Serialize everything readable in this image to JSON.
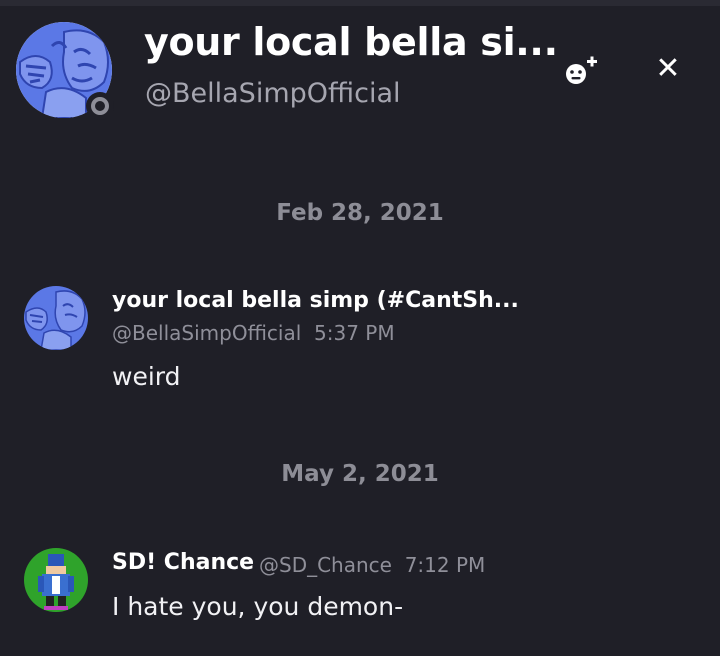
{
  "colors": {
    "background": "#1f1f27",
    "text_primary": "#ffffff",
    "text_muted": "#8f8f99",
    "avatar_blue": "#5b78e6",
    "status_offline": "#8e8e98"
  },
  "header": {
    "display_name": "your local bella si...",
    "handle": "@BellaSimpOfficial",
    "status": "offline",
    "add_friend_icon": "add-friend-icon",
    "close_icon": "close-icon",
    "close_glyph": "✕"
  },
  "messages": [
    {
      "date": "Feb 28, 2021",
      "author": "your local bella simp (#CantSh...",
      "handle": "@BellaSimpOfficial",
      "time": "5:37 PM",
      "text": "weird"
    },
    {
      "date": "May 2, 2021",
      "author": "SD! Chance",
      "handle": "@SD_Chance",
      "time": "7:12 PM",
      "text": "I hate you, you demon-"
    }
  ]
}
